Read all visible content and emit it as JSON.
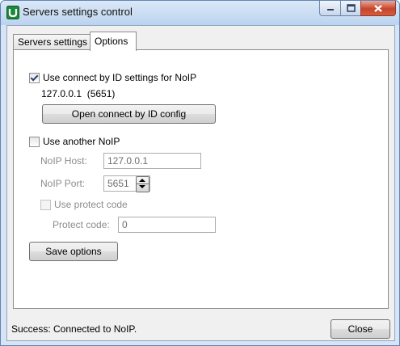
{
  "window": {
    "title": "Servers settings control"
  },
  "tabs": [
    {
      "label": "Servers settings",
      "active": false
    },
    {
      "label": "Options",
      "active": true
    }
  ],
  "options": {
    "use_connect_by_id": {
      "label": "Use connect by ID settings for NoIP",
      "checked": true
    },
    "current_address": "127.0.0.1  (5651)",
    "open_config_button": "Open connect by ID config",
    "use_another_noip": {
      "label": "Use another NoIP",
      "checked": false
    },
    "noip_host": {
      "label": "NoIP Host:",
      "value": "127.0.0.1"
    },
    "noip_port": {
      "label": "NoIP Port:",
      "value": "5651"
    },
    "use_protect_code": {
      "label": "Use protect code",
      "checked": false
    },
    "protect_code": {
      "label": "Protect code:",
      "value": "0"
    },
    "save_button": "Save options"
  },
  "status": {
    "text": "Success: Connected to NoIP."
  },
  "close_button": "Close"
}
